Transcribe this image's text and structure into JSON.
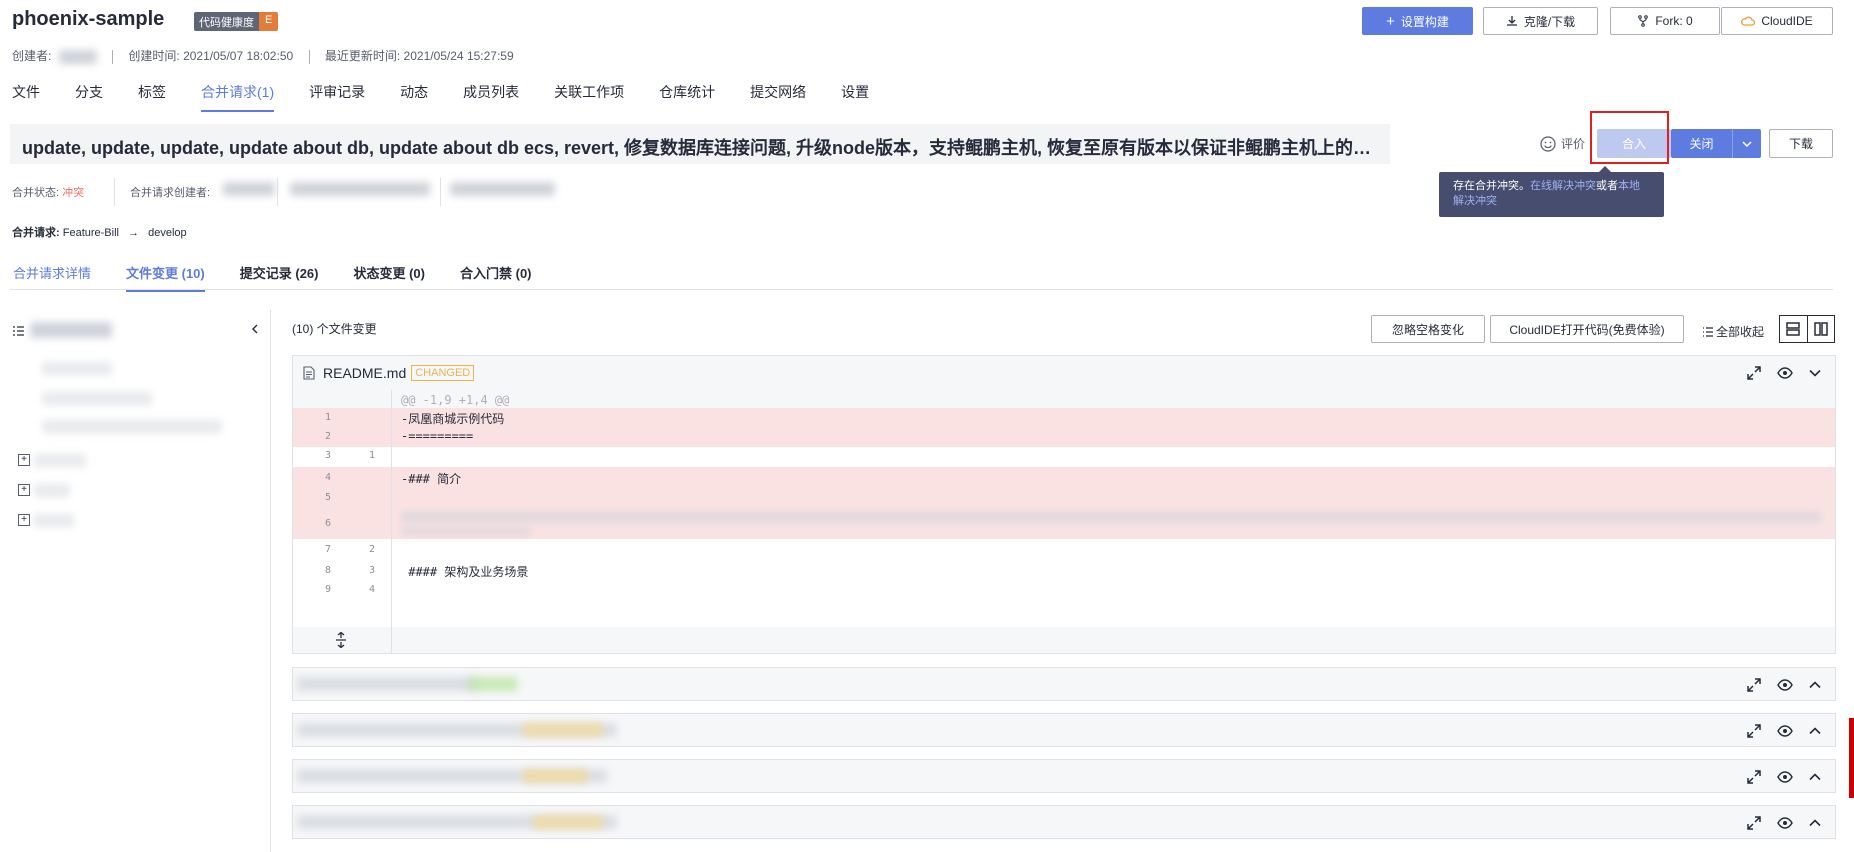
{
  "repo": {
    "name": "phoenix-sample",
    "health_label": "代码健康度",
    "health_grade": "E",
    "creator_label": "创建者:",
    "created_label": "创建时间:",
    "created_time": "2021/05/07 18:02:50",
    "updated_label": "最近更新时间:",
    "updated_time": "2021/05/24 15:27:59"
  },
  "top_buttons": {
    "build": "设置构建",
    "clone": "克隆/下载",
    "fork": "Fork: 0",
    "cloudide": "CloudIDE"
  },
  "nav": [
    "文件",
    "分支",
    "标签",
    "合并请求(1)",
    "评审记录",
    "动态",
    "成员列表",
    "关联工作项",
    "仓库统计",
    "提交网络",
    "设置"
  ],
  "mr": {
    "title": "update, update, update, update about db, update about db ecs, revert, 修复数据库连接问题, 升级node版本，支持鲲鹏主机, 恢复至原有版本以保证非鲲鹏主机上的运...",
    "rate": "评价",
    "merge": "合入",
    "close": "关闭",
    "download": "下载",
    "tooltip_text": "存在合并冲突。",
    "tooltip_link1": "在线解决冲突",
    "tooltip_mid": "或者",
    "tooltip_link2": "本地解决冲突",
    "status_label": "合并状态:",
    "status_value": "冲突",
    "creator_label": "合并请求创建者:",
    "branch_label": "合并请求:",
    "source_branch": "Feature-Bill",
    "arrow": "→",
    "target_branch": "develop"
  },
  "subtabs": [
    "合并请求详情",
    "文件变更 (10)",
    "提交记录 (26)",
    "状态变更 (0)",
    "合入门禁 (0)"
  ],
  "diff": {
    "files_count": "(10) 个文件变更",
    "ignore_ws": "忽略空格变化",
    "open_cloudide": "CloudIDE打开代码(免费体验)",
    "collapse_all": "全部收起",
    "file_name": "README.md",
    "file_tag": "CHANGED",
    "hunk": "@@ -1,9 +1,4 @@",
    "lines": [
      {
        "o": "1",
        "n": "",
        "t": "-凤凰商城示例代码",
        "type": "del"
      },
      {
        "o": "2",
        "n": "",
        "t": "-=========",
        "type": "del"
      },
      {
        "o": "3",
        "n": "1",
        "t": "",
        "type": "ctx"
      },
      {
        "o": "4",
        "n": "",
        "t": "-### 简介",
        "type": "del"
      },
      {
        "o": "5",
        "n": "",
        "t": "",
        "type": "del"
      },
      {
        "o": "6",
        "n": "",
        "t": "",
        "type": "del"
      },
      {
        "o": "7",
        "n": "2",
        "t": "",
        "type": "ctx"
      },
      {
        "o": "8",
        "n": "3",
        "t": " #### 架构及业务场景",
        "type": "ctx"
      },
      {
        "o": "9",
        "n": "4",
        "t": "",
        "type": "ctx"
      }
    ]
  }
}
